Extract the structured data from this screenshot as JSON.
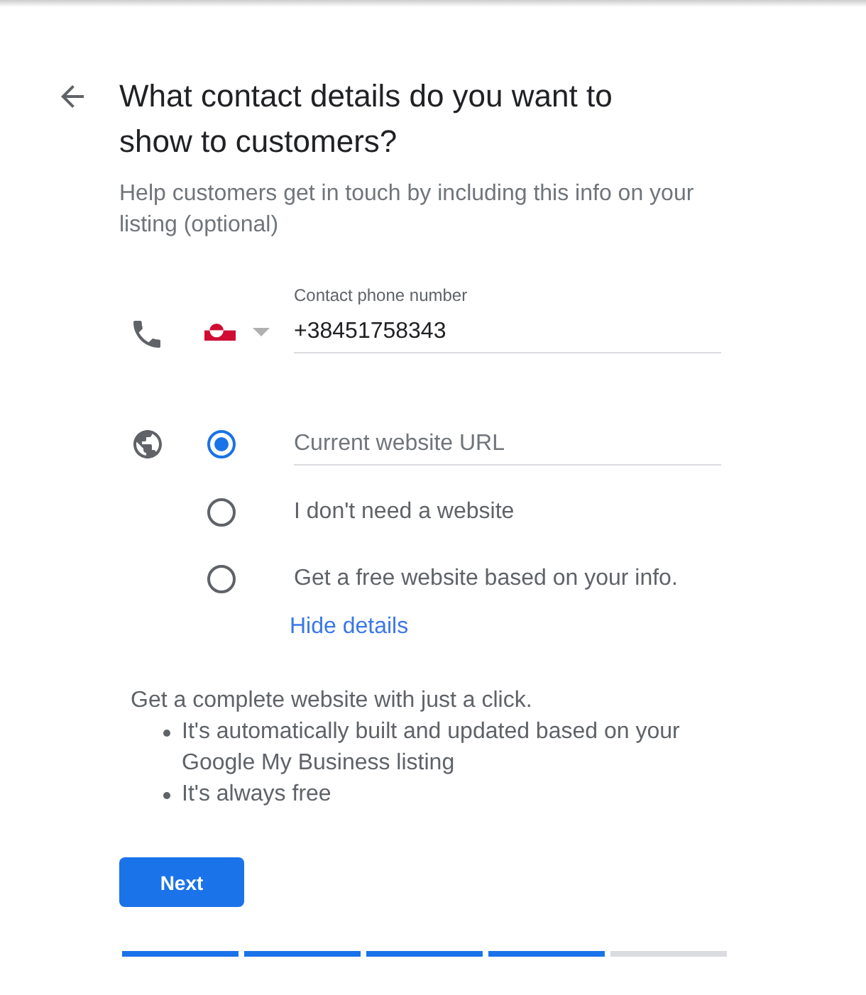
{
  "header": {
    "title": "What contact details do you want to show to customers?",
    "subtitle": "Help customers get in touch by including this info on your listing (optional)"
  },
  "phone": {
    "label": "Contact phone number",
    "value": "+38451758343"
  },
  "website": {
    "options": [
      {
        "kind": "url_field",
        "placeholder": "Current website URL",
        "selected": true
      },
      {
        "kind": "choice",
        "label": "I don't need a website",
        "selected": false
      },
      {
        "kind": "choice",
        "label": "Get a free website based on your info.",
        "selected": false
      }
    ]
  },
  "details": {
    "toggle": "Hide details",
    "intro": "Get a complete website with just a click.",
    "bullets": [
      "It's automatically built and updated based on your Google My Business listing",
      "It's always free"
    ]
  },
  "next_button": "Next",
  "progress": [
    {
      "completed": true
    },
    {
      "completed": true
    },
    {
      "completed": true
    },
    {
      "completed": true
    },
    {
      "completed": false
    }
  ]
}
